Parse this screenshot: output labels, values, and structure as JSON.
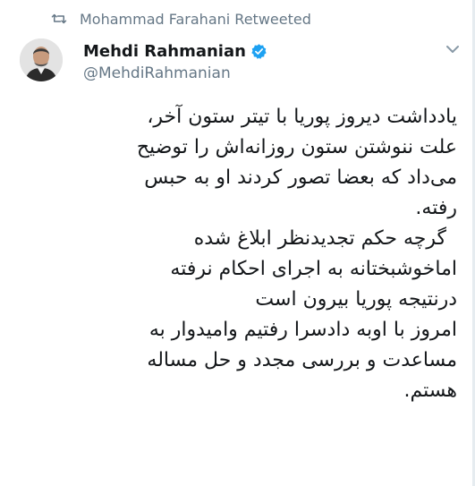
{
  "retweet": {
    "icon": "retweet-icon",
    "label": "Mohammad Farahani Retweeted"
  },
  "author": {
    "avatar": "avatar",
    "display_name": "Mehdi Rahmanian",
    "verified_icon": "verified-badge-icon",
    "handle": "@MehdiRahmanian"
  },
  "menu": {
    "icon": "chevron-down-icon"
  },
  "tweet": {
    "lines": [
      "یادداشت دیروز پوریا با تیتر ستون آخر،",
      "علت ننوشتن ستون روزانه‌اش را توضیح",
      "می‌داد که بعضا تصور کردند او به حبس",
      "رفته.",
      "گرچه حکم تجدیدنظر ابلاغ شده",
      "اماخوشبختانه به اجرای احکام نرفته",
      "درنتیجه پوریا بیرون است",
      "امروز با اوبه دادسرا رفتیم وامیدوار به",
      "مساعدت و بررسی مجدد و حل مساله",
      "هستم."
    ]
  },
  "colors": {
    "verified_blue": "#1da1f2",
    "secondary_text": "#657786",
    "primary_text": "#14171a"
  }
}
